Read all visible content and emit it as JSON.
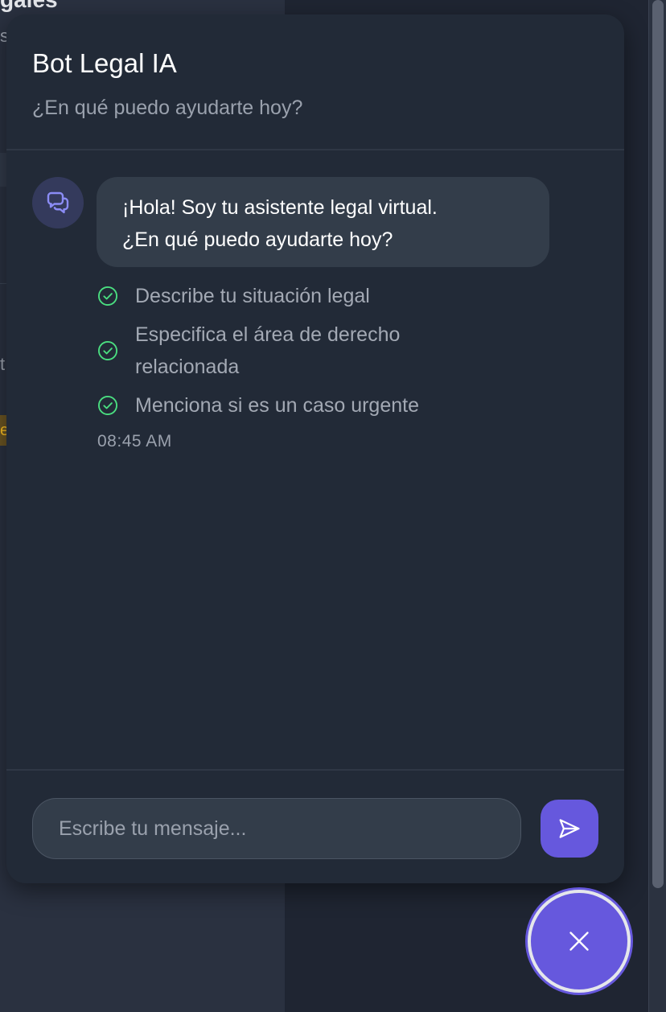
{
  "background": {
    "top_fragment": "gales",
    "s_fragment": "s",
    "t_fragment": "t",
    "e_fragment": "e"
  },
  "chat": {
    "title": "Bot Legal IA",
    "subtitle": "¿En qué puedo ayudarte hoy?",
    "avatar_icon": "chat-bubbles-icon",
    "message": {
      "line1": "¡Hola! Soy tu asistente legal virtual.",
      "line2": "¿En qué puedo ayudarte hoy?",
      "time": "08:45 AM"
    },
    "checklist": [
      {
        "icon": "check-circle-icon",
        "text": "Describe tu situación legal"
      },
      {
        "icon": "check-circle-icon",
        "text": "Especifica el área de derecho relacionada"
      },
      {
        "icon": "check-circle-icon",
        "text": "Menciona si es un caso urgente"
      }
    ],
    "input": {
      "placeholder": "Escribe tu mensaje...",
      "value": ""
    },
    "send_icon": "send-icon",
    "close_icon": "close-icon"
  },
  "colors": {
    "accent": "#6658dd",
    "check_green": "#4ade80",
    "panel_bg": "#222a37",
    "bubble_bg": "#333d4a"
  }
}
